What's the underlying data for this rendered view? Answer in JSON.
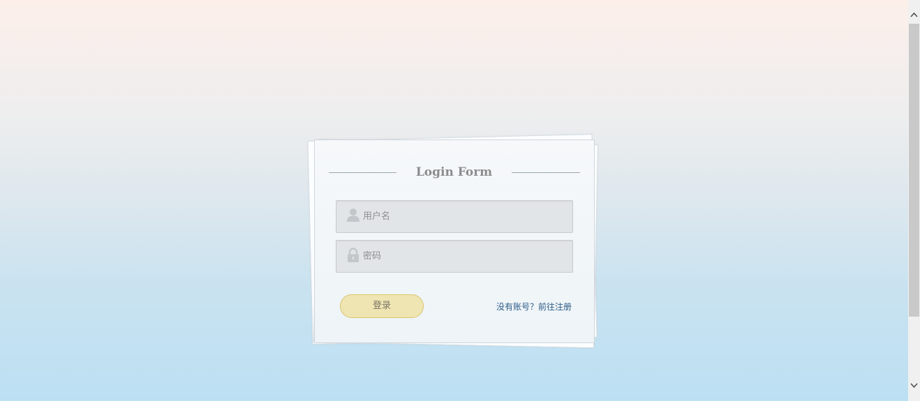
{
  "form": {
    "title": "Login Form",
    "username": {
      "placeholder": "用户名",
      "value": "",
      "icon": "user-icon"
    },
    "password": {
      "placeholder": "密码",
      "value": "",
      "icon": "lock-icon"
    },
    "login_label": "登录",
    "register_link": "没有账号？前往注册"
  },
  "colors": {
    "button_fill": "#efe5b3",
    "button_border": "#d9c56a",
    "link": "#2b5c86",
    "title": "#8c8c8c"
  },
  "scrollbar": {
    "up_icon": "chevron-up-icon",
    "down_icon": "chevron-down-icon"
  }
}
